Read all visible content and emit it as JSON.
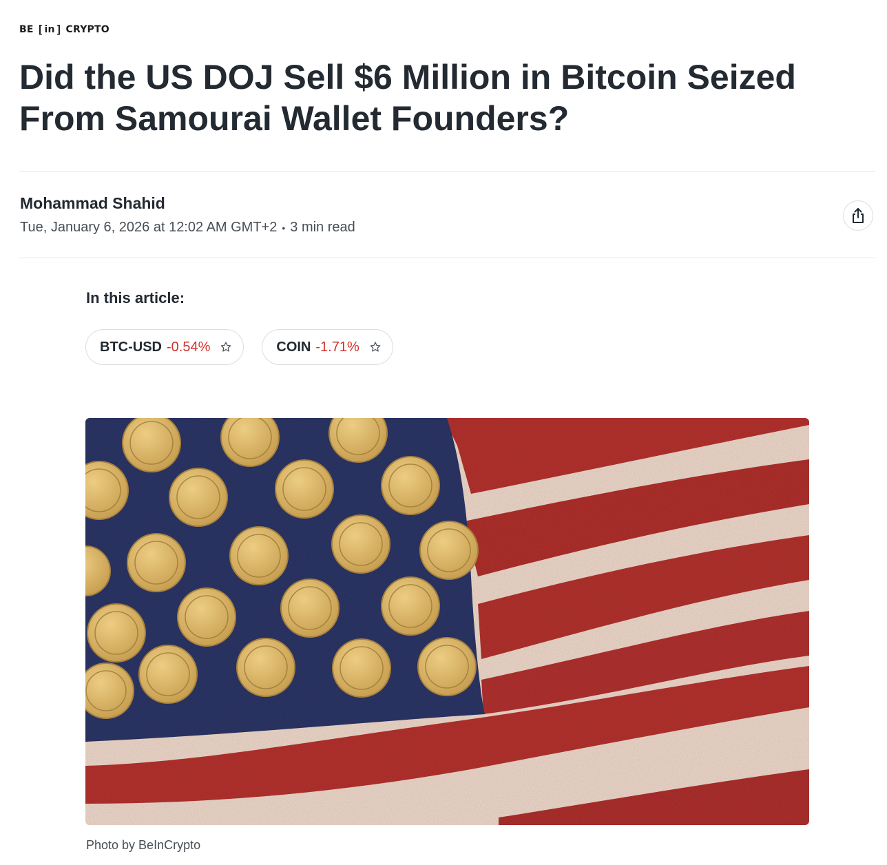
{
  "header": {
    "logo_left": "BE",
    "logo_bracket_open": "[",
    "logo_mid": "in",
    "logo_bracket_close": "]",
    "logo_right": "CRYPTO"
  },
  "article": {
    "title": "Did the US DOJ Sell $6 Million in Bitcoin Seized From Samourai Wallet Founders?",
    "author": "Mohammad Shahid",
    "date": "Tue, January 6, 2026 at 12:02 AM GMT+2",
    "separator": "•",
    "read_time": "3 min read",
    "share_icon": "share-icon"
  },
  "in_article": {
    "label": "In this article:",
    "tickers": [
      {
        "symbol": "BTC-USD",
        "change": "-0.54%",
        "icon": "star-icon"
      },
      {
        "symbol": "COIN",
        "change": "-1.71%",
        "icon": "star-icon"
      }
    ]
  },
  "hero": {
    "caption": "Photo by BeInCrypto"
  },
  "colors": {
    "text": "#232a31",
    "muted": "#464e56",
    "negative": "#d0302c",
    "flag_blue": "#2c3566",
    "flag_red": "#b3322e",
    "flag_white": "#f0dccf",
    "coin_gold": "#d9b565"
  }
}
